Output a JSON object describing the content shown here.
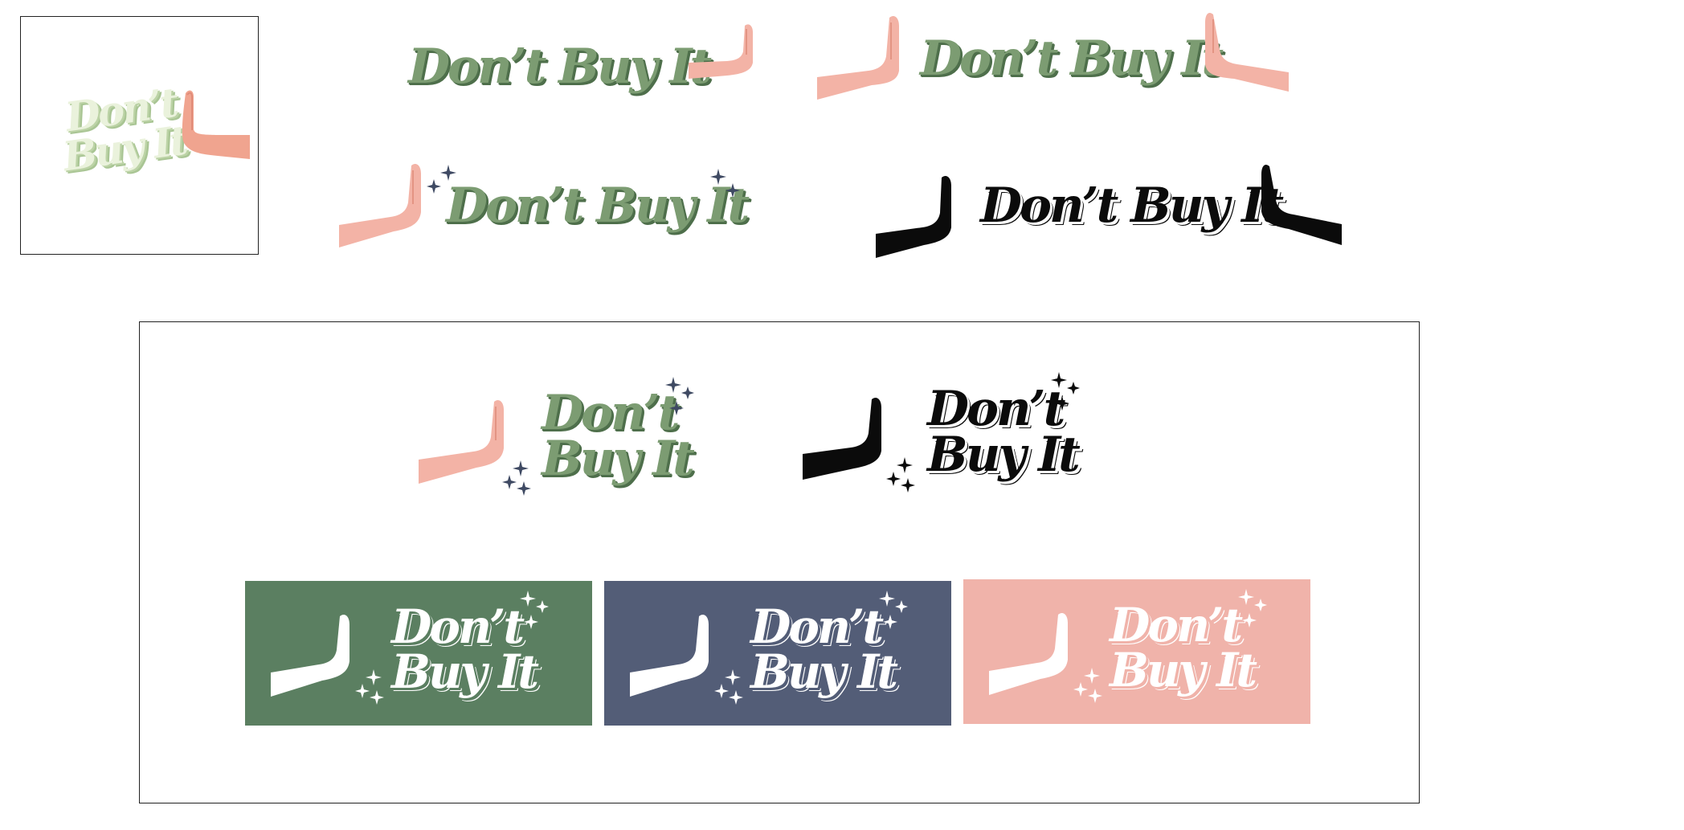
{
  "logo_text": {
    "single_line": "Don’t Buy It",
    "line1": "Don’t",
    "line2": "Buy It"
  },
  "colors": {
    "sage_green": "#7c9c72",
    "sage_dark": "#4e6f4b",
    "panel_green": "#5b7f61",
    "panel_slate": "#535d77",
    "panel_pink": "#f0b3aa",
    "skin": "#f3b3a6",
    "sparkle": "#3f4a63",
    "black": "#0b0b0b",
    "white": "#ffffff"
  },
  "icons": [
    "stop-hand-icon",
    "sparkles-icon"
  ]
}
